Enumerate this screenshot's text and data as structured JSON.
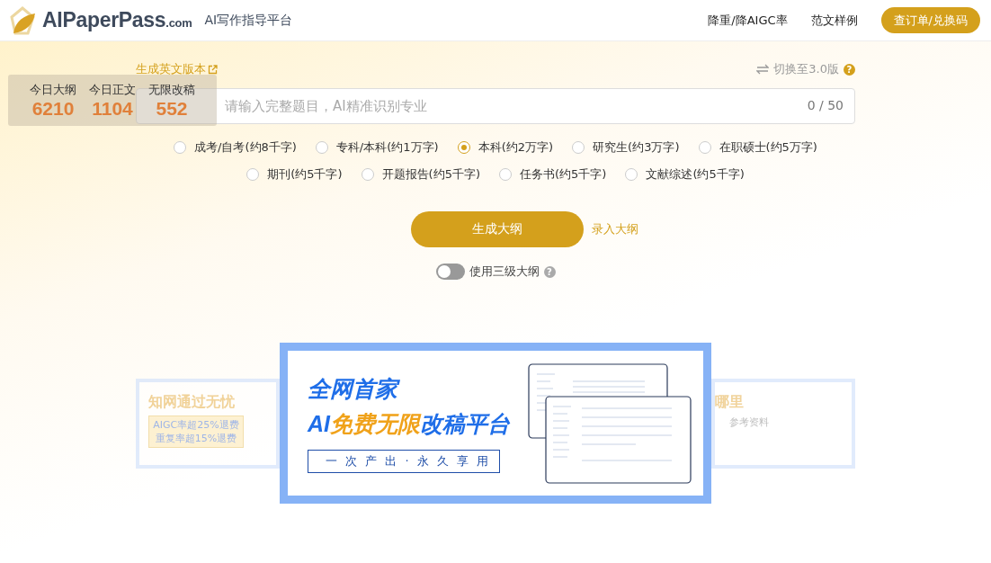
{
  "header": {
    "logo_text": "AIPaperPass",
    "logo_suffix": ".com",
    "tagline": "AI写作指导平台",
    "nav": [
      {
        "label": "降重/降AIGC率",
        "kind": "link"
      },
      {
        "label": "范文样例",
        "kind": "link"
      },
      {
        "label": "查订单/兑换码",
        "kind": "button"
      }
    ]
  },
  "stats": [
    {
      "label": "今日大纲",
      "value": "6210"
    },
    {
      "label": "今日正文",
      "value": "1104"
    },
    {
      "label": "无限改稿",
      "value": "552"
    }
  ],
  "english_link": "生成英文版本",
  "switch_version": "切换至3.0版",
  "switch_help": "?",
  "title_field": {
    "placeholder": "请输入完整题目，AI精准识别专业",
    "counter": "0 / 50"
  },
  "paper_type_rows": [
    {
      "options": [
        {
          "label": "成考/自考(约8千字)",
          "selected": false
        },
        {
          "label": "专科/本科(约1万字)",
          "selected": false
        },
        {
          "label": "本科(约2万字)",
          "selected": true
        },
        {
          "label": "研究生(约3万字)",
          "selected": false
        },
        {
          "label": "在职硕士(约5万字)",
          "selected": false
        }
      ]
    },
    {
      "options": [
        {
          "label": "期刊(约5千字)",
          "selected": false
        },
        {
          "label": "开题报告(约5千字)",
          "selected": false
        },
        {
          "label": "任务书(约5千字)",
          "selected": false
        },
        {
          "label": "文献综述(约5千字)",
          "selected": false
        }
      ]
    }
  ],
  "generate_button": "生成大纲",
  "import_link": "录入大纲",
  "three_level": {
    "label": "使用三级大纲",
    "help": "?",
    "on": false
  },
  "banner": {
    "slides": [
      {
        "kind": "side",
        "title": "知网通过无忧",
        "badges": [
          "AIGC率超25%退费",
          "重复率超15%退费"
        ]
      },
      {
        "kind": "main",
        "headline": "全网首家",
        "parts": [
          {
            "text": "AI",
            "highlight": false
          },
          {
            "text": "免费无限",
            "highlight": true
          },
          {
            "text": "改稿平台",
            "highlight": false
          }
        ],
        "tagline": "一次产出·永久享用"
      },
      {
        "kind": "side-right",
        "title": "哪里",
        "subtitle": "参考资料"
      }
    ]
  }
}
